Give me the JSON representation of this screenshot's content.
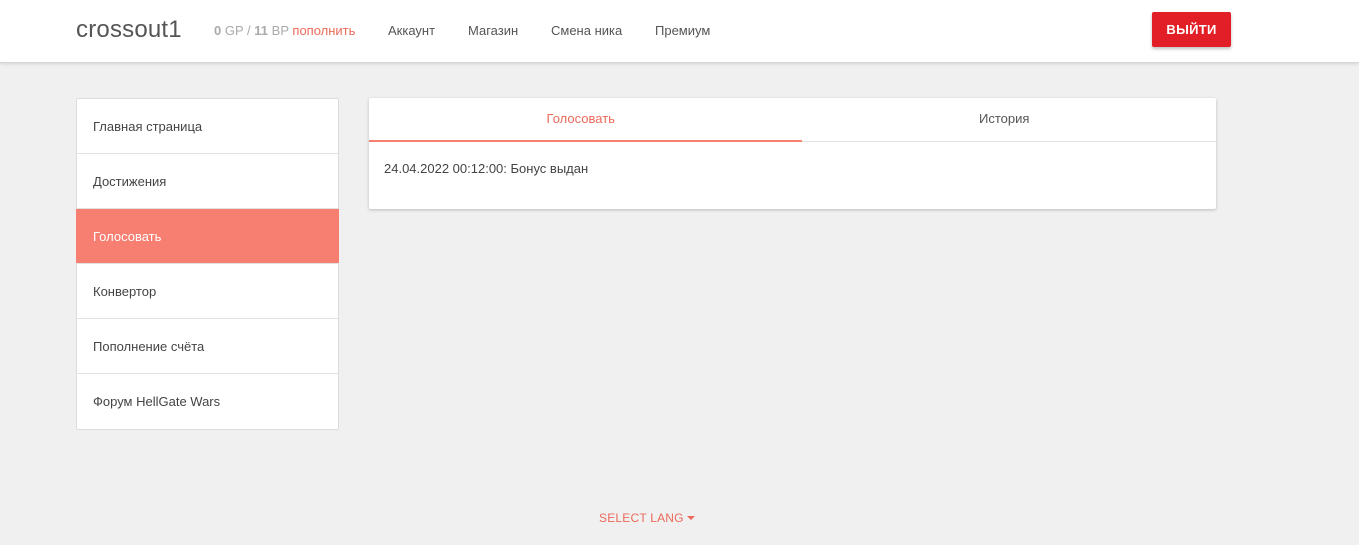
{
  "header": {
    "brand": "crossout1",
    "balance": {
      "gp_value": "0",
      "gp_unit": "GP",
      "separator": "/",
      "bp_value": "11",
      "bp_unit": "BP",
      "topup_label": "пополнить"
    },
    "nav": [
      {
        "label": "Аккаунт"
      },
      {
        "label": "Магазин"
      },
      {
        "label": "Смена ника"
      },
      {
        "label": "Премиум"
      }
    ],
    "logout_label": "ВЫЙТИ"
  },
  "sidebar": {
    "items": [
      {
        "label": "Главная страница"
      },
      {
        "label": "Достижения"
      },
      {
        "label": "Голосовать",
        "active": true
      },
      {
        "label": "Конвертор"
      },
      {
        "label": "Пополнение счёта"
      },
      {
        "label": "Форум HellGate Wars"
      }
    ]
  },
  "panel": {
    "tabs": [
      {
        "label": "Голосовать",
        "active": true
      },
      {
        "label": "История"
      }
    ],
    "log": "24.04.2022 00:12:00: Бонус выдан"
  },
  "footer": {
    "lang_label": "SELECT LANG"
  },
  "colors": {
    "accent": "#f77f72",
    "accent_text": "#ea6a5a",
    "logout_bg": "#e21f26",
    "page_bg": "#f0f0f0"
  }
}
